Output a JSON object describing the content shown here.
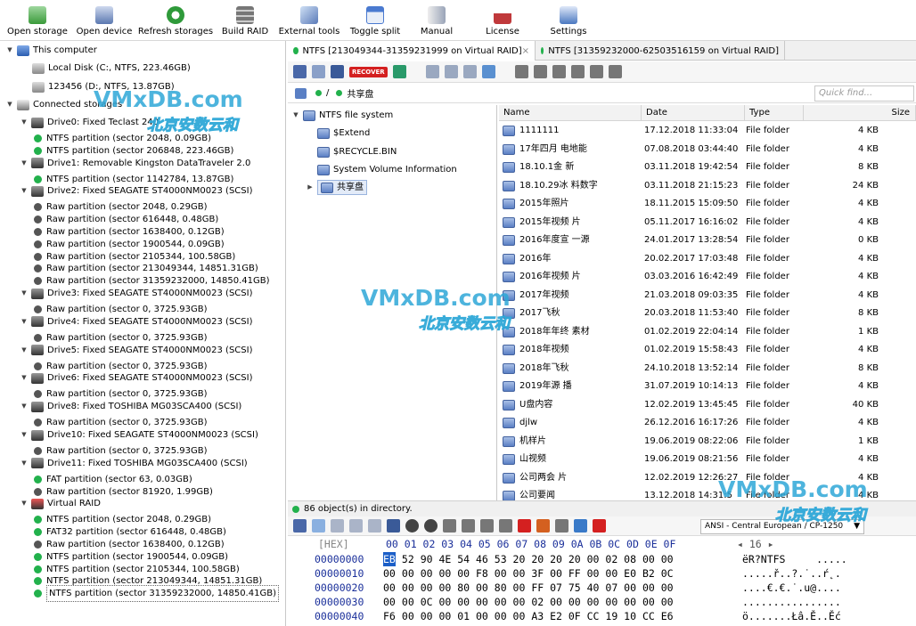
{
  "toolbar": {
    "items": [
      {
        "label": "Open storage",
        "icon": "open-storage-icon",
        "color": "#3a9a3a"
      },
      {
        "label": "Open device",
        "icon": "open-device-icon",
        "color": "#5a78b0"
      },
      {
        "label": "Refresh storages",
        "icon": "refresh-icon",
        "color": "#2f9a3a"
      },
      {
        "label": "Build RAID",
        "icon": "raid-icon",
        "color": "#555555"
      },
      {
        "label": "External tools",
        "icon": "tools-icon",
        "color": "#5a7ab8"
      },
      {
        "label": "Toggle split",
        "icon": "split-icon",
        "color": "#4a7ad0"
      },
      {
        "label": "Manual",
        "icon": "manual-icon",
        "color": "#606a80"
      },
      {
        "label": "License",
        "icon": "license-icon",
        "color": "#c0393b"
      },
      {
        "label": "Settings",
        "icon": "settings-icon",
        "color": "#4a78c0"
      }
    ]
  },
  "left_tree": {
    "this_computer": "This computer",
    "local_disk": "Local Disk (C:, NTFS, 223.46GB)",
    "usb_disk": "123456 (D:, NTFS, 13.87GB)",
    "connected": "Connected storages",
    "items": [
      {
        "label": "Drive0: Fixed Teclast 240",
        "kind": "drive"
      },
      {
        "label": "NTFS partition (sector 2048, 0.09GB)",
        "kind": "green"
      },
      {
        "label": "NTFS partition (sector 206848, 223.46GB)",
        "kind": "green"
      },
      {
        "label": "Drive1: Removable Kingston DataTraveler 2.0",
        "kind": "drive"
      },
      {
        "label": "NTFS partition (sector 1142784, 13.87GB)",
        "kind": "green"
      },
      {
        "label": "Drive2: Fixed SEAGATE ST4000NM0023 (SCSI)",
        "kind": "drive"
      },
      {
        "label": "Raw partition (sector 2048, 0.29GB)",
        "kind": "gray"
      },
      {
        "label": "Raw partition (sector 616448, 0.48GB)",
        "kind": "gray"
      },
      {
        "label": "Raw partition (sector 1638400, 0.12GB)",
        "kind": "gray"
      },
      {
        "label": "Raw partition (sector 1900544, 0.09GB)",
        "kind": "gray"
      },
      {
        "label": "Raw partition (sector 2105344, 100.58GB)",
        "kind": "gray"
      },
      {
        "label": "Raw partition (sector 213049344, 14851.31GB)",
        "kind": "gray"
      },
      {
        "label": "Raw partition (sector 31359232000, 14850.41GB)",
        "kind": "gray"
      },
      {
        "label": "Drive3: Fixed SEAGATE ST4000NM0023 (SCSI)",
        "kind": "drive"
      },
      {
        "label": "Raw partition (sector 0, 3725.93GB)",
        "kind": "gray"
      },
      {
        "label": "Drive4: Fixed SEAGATE ST4000NM0023 (SCSI)",
        "kind": "drive"
      },
      {
        "label": "Raw partition (sector 0, 3725.93GB)",
        "kind": "gray"
      },
      {
        "label": "Drive5: Fixed SEAGATE ST4000NM0023 (SCSI)",
        "kind": "drive"
      },
      {
        "label": "Raw partition (sector 0, 3725.93GB)",
        "kind": "gray"
      },
      {
        "label": "Drive6: Fixed SEAGATE ST4000NM0023 (SCSI)",
        "kind": "drive"
      },
      {
        "label": "Raw partition (sector 0, 3725.93GB)",
        "kind": "gray"
      },
      {
        "label": "Drive8: Fixed TOSHIBA MG03SCA400 (SCSI)",
        "kind": "drive"
      },
      {
        "label": "Raw partition (sector 0, 3725.93GB)",
        "kind": "gray"
      },
      {
        "label": "Drive10: Fixed SEAGATE ST4000NM0023 (SCSI)",
        "kind": "drive"
      },
      {
        "label": "Raw partition (sector 0, 3725.93GB)",
        "kind": "gray"
      },
      {
        "label": "Drive11: Fixed TOSHIBA MG03SCA400 (SCSI)",
        "kind": "drive"
      },
      {
        "label": "FAT partition (sector 63, 0.03GB)",
        "kind": "green"
      },
      {
        "label": "Raw partition (sector 81920, 1.99GB)",
        "kind": "gray"
      },
      {
        "label": "Virtual RAID",
        "kind": "raid"
      },
      {
        "label": "NTFS partition (sector 2048, 0.29GB)",
        "kind": "green"
      },
      {
        "label": "FAT32 partition (sector 616448, 0.48GB)",
        "kind": "green"
      },
      {
        "label": "Raw partition (sector 1638400, 0.12GB)",
        "kind": "gray"
      },
      {
        "label": "NTFS partition (sector 1900544, 0.09GB)",
        "kind": "green"
      },
      {
        "label": "NTFS partition (sector 2105344, 100.58GB)",
        "kind": "green"
      },
      {
        "label": "NTFS partition (sector 213049344, 14851.31GB)",
        "kind": "green"
      },
      {
        "label": "NTFS partition (sector 31359232000, 14850.41GB)",
        "kind": "green"
      }
    ]
  },
  "tabs": [
    {
      "label": "NTFS [213049344-31359231999 on Virtual RAID]",
      "close": "×"
    },
    {
      "label": "NTFS [31359232000-62503516159 on Virtual RAID]"
    }
  ],
  "path": {
    "root": "/",
    "current": "共享盘"
  },
  "quick_find": {
    "placeholder": "Quick find..."
  },
  "fs_tree": {
    "root": "NTFS file system",
    "items": [
      "$Extend",
      "$RECYCLE.BIN",
      "System Volume Information",
      "共享盘"
    ]
  },
  "file_list": {
    "columns": [
      "Name",
      "Date",
      "Type",
      "Size"
    ],
    "rows": [
      [
        "1111111",
        "17.12.2018 11:33:04",
        "File folder",
        "4 KB"
      ],
      [
        "17年四月     电地能",
        "07.08.2018 03:44:40",
        "File folder",
        "4 KB"
      ],
      [
        "18.10.1金   新",
        "03.11.2018 19:42:54",
        "File folder",
        "8 KB"
      ],
      [
        "18.10.29冰   料数字",
        "03.11.2018 21:15:23",
        "File folder",
        "24 KB"
      ],
      [
        "2015年照片",
        "18.11.2015 15:09:50",
        "File folder",
        "4 KB"
      ],
      [
        "2015年视频     片",
        "05.11.2017 16:16:02",
        "File folder",
        "4 KB"
      ],
      [
        "2016年度宣   一源",
        "24.01.2017 13:28:54",
        "File folder",
        "0 KB"
      ],
      [
        "2016年",
        "20.02.2017 17:03:48",
        "File folder",
        "4 KB"
      ],
      [
        "2016年视频    片",
        "03.03.2016 16:42:49",
        "File folder",
        "4 KB"
      ],
      [
        "2017年视频",
        "21.03.2018 09:03:35",
        "File folder",
        "4 KB"
      ],
      [
        "2017飞秋",
        "20.03.2018 11:53:40",
        "File folder",
        "8 KB"
      ],
      [
        "2018年年终     素材",
        "01.02.2019 22:04:14",
        "File folder",
        "1 KB"
      ],
      [
        "2018年视频",
        "01.02.2019 15:58:43",
        "File folder",
        "4 KB"
      ],
      [
        "2018年飞秋",
        "24.10.2018 13:52:14",
        "File folder",
        "8 KB"
      ],
      [
        "2019年源    播",
        "31.07.2019 10:14:13",
        "File folder",
        "4 KB"
      ],
      [
        "U盘内容",
        "12.02.2019 13:45:45",
        "File folder",
        "40 KB"
      ],
      [
        "djlw",
        "26.12.2016 16:17:26",
        "File folder",
        "4 KB"
      ],
      [
        "   机样片",
        "19.06.2019 08:22:06",
        "File folder",
        "1 KB"
      ],
      [
        "   山视频",
        "19.06.2019 08:21:56",
        "File folder",
        "4 KB"
      ],
      [
        "公司两会    片",
        "12.02.2019 12:26:27",
        "File folder",
        "4 KB"
      ],
      [
        "公司要闻",
        "13.12.2018 14:31:5",
        "File folder",
        "4 KB"
      ]
    ]
  },
  "status": {
    "text": "86 object(s) in directory."
  },
  "hex": {
    "encoding": "ANSI - Central European / CP-1250",
    "bytes_per_row": "16",
    "header_label": "[HEX]",
    "header": "00 01 02 03 04 05 06 07 08 09 0A 0B 0C 0D 0E 0F",
    "rows": [
      {
        "addr": "00000000",
        "first": "EB",
        "rest": " 52 90 4E 54 46 53 20 20 20 20 00 02 08 00 00",
        "ascii": "ëR?NTFS     ....."
      },
      {
        "addr": "00000010",
        "first": "00",
        "rest": " 00 00 00 00 F8 00 00 3F 00 FF 00 00 E0 B2 0C",
        "ascii": ".....ř..?.˙..ŕ˛."
      },
      {
        "addr": "00000020",
        "first": "00",
        "rest": " 00 00 00 80 00 80 00 FF 07 75 40 07 00 00 00",
        "ascii": "....€.€.˙.u@...."
      },
      {
        "addr": "00000030",
        "first": "00",
        "rest": " 00 0C 00 00 00 00 00 02 00 00 00 00 00 00 00",
        "ascii": "................"
      },
      {
        "addr": "00000040",
        "first": "F6",
        "rest": " 00 00 00 01 00 00 00 A3 E2 0F CC 19 10 CC E6",
        "ascii": "ö.......Łâ.Ě..Ěć"
      }
    ]
  },
  "watermark": {
    "brand": "VMxDB.com",
    "sub": "北京安数云和"
  },
  "colors": {
    "green_dot": "#22b14c",
    "gray_dot": "#555555",
    "hex_selected": "#1c5fc8",
    "hex_text": "#000000",
    "addr_text": "#1a2f9a"
  }
}
